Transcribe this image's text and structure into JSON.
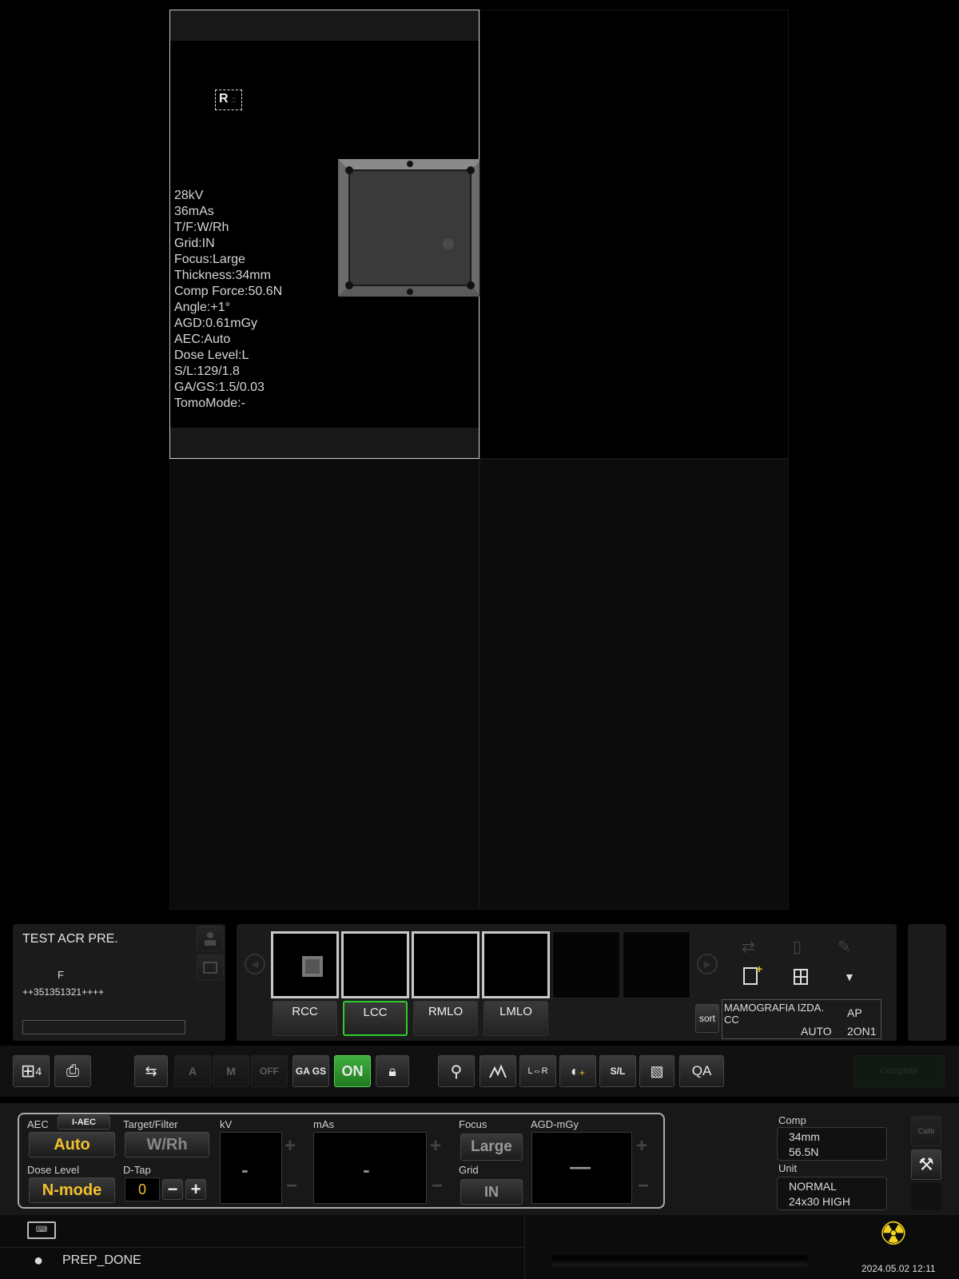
{
  "viewer": {
    "marker_letter": "R",
    "marker_sub": "::",
    "exposure_info": [
      "28kV",
      "36mAs",
      "T/F:W/Rh",
      "Grid:IN",
      "Focus:Large",
      "Thickness:34mm",
      "Comp Force:50.6N",
      "Angle:+1°",
      "AGD:0.61mGy",
      "AEC:Auto",
      "Dose Level:L",
      "S/L:129/1.8",
      "GA/GS:1.5/0.03",
      "TomoMode:-"
    ]
  },
  "patient": {
    "name": "TEST ACR PRE.",
    "sex": "F",
    "id": "++351351321++++"
  },
  "views": [
    {
      "label": "RCC",
      "selected": false
    },
    {
      "label": "LCC",
      "selected": true
    },
    {
      "label": "RMLO",
      "selected": false
    },
    {
      "label": "LMLO",
      "selected": false
    }
  ],
  "study": {
    "sort_label": "sort",
    "protocol_line1": "MAMOGRAFIA IZDA.",
    "protocol_line2": "CC",
    "mode": "AUTO",
    "ap": "AP",
    "combo": "2ON1"
  },
  "toolbar": {
    "layout_count": "4",
    "gags_label": "GA GS",
    "aon_label": "ON",
    "off_label": "OFF",
    "sl_label": "S/L",
    "qa_label": "QA",
    "complete_label": "Complete"
  },
  "exposure": {
    "aec_label": "AEC",
    "iaec_label": "I-AEC",
    "aec_value": "Auto",
    "tf_label": "Target/Filter",
    "tf_value": "W/Rh",
    "kv_label": "kV",
    "kv_value": "-",
    "mas_label": "mAs",
    "mas_value": "-",
    "focus_label": "Focus",
    "focus_value": "Large",
    "agd_label": "AGD-mGy",
    "agd_value": "—",
    "dose_label": "Dose Level",
    "dose_value": "N-mode",
    "dtap_label": "D-Tap",
    "dtap_value": "0",
    "grid_label": "Grid",
    "grid_value": "IN",
    "comp_label": "Comp",
    "comp_thickness": "34mm",
    "comp_force": "56.5N",
    "unit_label": "Unit",
    "unit_line1": "NORMAL",
    "unit_line2": "24x30 HIGH",
    "calib_label": "Calib"
  },
  "status": {
    "state": "PREP_DONE",
    "datetime": "2024.05.02 12:11"
  }
}
